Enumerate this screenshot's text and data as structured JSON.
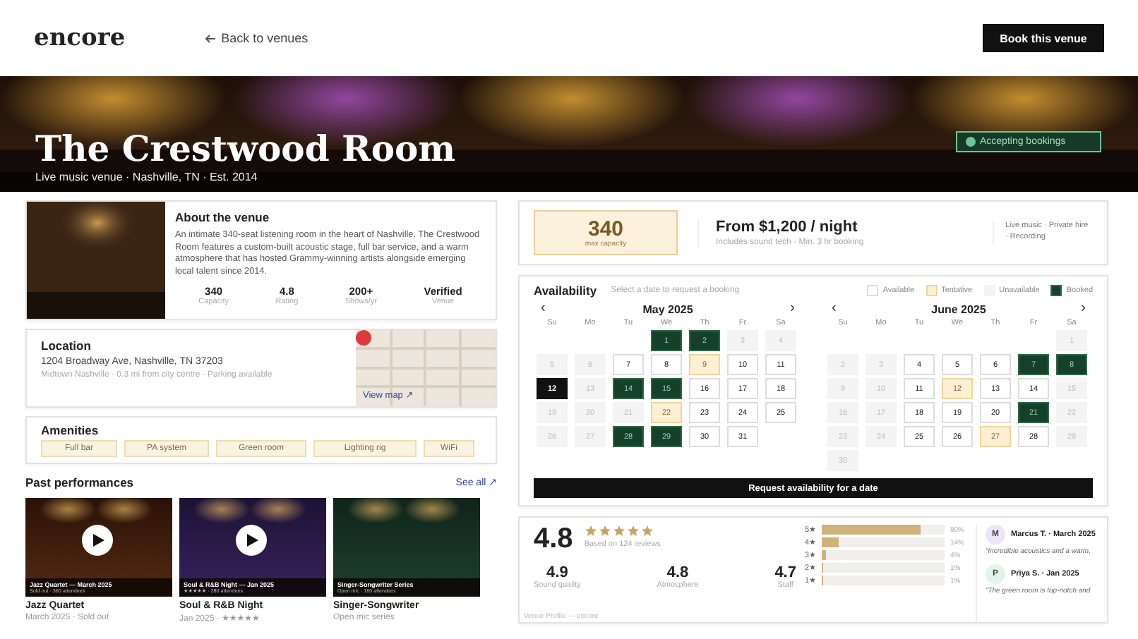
{
  "header": {
    "logo": "encore",
    "back_link": "Back to venues",
    "book_button": "Book this venue"
  },
  "hero": {
    "title": "The Crestwood Room",
    "meta": "Live music venue · Nashville, TN · Est. 2014",
    "status": "Accepting bookings"
  },
  "about": {
    "title": "About the venue",
    "text": "An intimate 340-seat listening room in the heart of Nashville. The Crestwood Room features a custom-built acoustic stage, full bar service, and a warm atmosphere that has hosted Grammy-winning artists alongside emerging local talent since 2014.",
    "stats": [
      {
        "value": "340",
        "label": "Capacity"
      },
      {
        "value": "4.8",
        "label": "Rating"
      },
      {
        "value": "200+",
        "label": "Shows/yr"
      },
      {
        "value": "Verified",
        "label": "Venue"
      }
    ]
  },
  "location": {
    "title": "Location",
    "address": "1204 Broadway Ave, Nashville, TN 37203",
    "details": "Midtown Nashville · 0.3 mi from city centre · Parking available",
    "map_link": "View map ↗"
  },
  "amenities": {
    "title": "Amenities",
    "items": [
      "Full bar",
      "PA system",
      "Green room",
      "Lighting rig",
      "WiFi"
    ]
  },
  "past_performances": {
    "title": "Past performances",
    "see_all": "See all ↗",
    "items": [
      {
        "caption": "Jazz Quartet — March 2025",
        "caption_sub": "Sold out · 360 attendees",
        "playable": true,
        "title": "Jazz Quartet",
        "meta": "March 2025 · Sold out"
      },
      {
        "caption": "Soul & R&B Night — Jan 2025",
        "caption_sub": "★★★★★ · 280 attendees",
        "playable": true,
        "title": "Soul & R&B Night",
        "meta": "Jan 2025 · ★★★★★"
      },
      {
        "caption": "Singer-Songwriter Series",
        "caption_sub": "Open mic · 160 attendees",
        "playable": false,
        "title": "Singer-Songwriter",
        "meta": "Open mic series"
      }
    ]
  },
  "pricing": {
    "capacity": "340",
    "capacity_label": "max capacity",
    "price": "From $1,200 / night",
    "price_note": "Includes sound tech · Min. 3 hr booking",
    "uses": "Live music · Private hire · Recording"
  },
  "availability": {
    "title": "Availability",
    "subtitle": "Select a date to request a booking",
    "legend": [
      {
        "label": "Available",
        "kind": "available"
      },
      {
        "label": "Tentative",
        "kind": "tentative"
      },
      {
        "label": "Unavailable",
        "kind": "unavailable"
      },
      {
        "label": "Booked",
        "kind": "booked"
      }
    ],
    "months": [
      {
        "title": "May 2025",
        "prev": "‹",
        "next": "›",
        "weekdays": [
          "Su",
          "Mo",
          "Tu",
          "We",
          "Th",
          "Fr",
          "Sa"
        ],
        "weeks": [
          [
            {
              "day": "1",
              "kind": "booked",
              "selected": false
            },
            {
              "day": "2",
              "kind": "booked",
              "selected": false
            },
            {
              "day": "3",
              "kind": "unavailable",
              "selected": false
            },
            {
              "day": "4",
              "kind": "unavailable",
              "selected": false
            }
          ],
          [
            {
              "day": "5",
              "kind": "unavailable",
              "selected": false
            },
            {
              "day": "6",
              "kind": "unavailable",
              "selected": false
            },
            {
              "day": "7",
              "kind": "available",
              "selected": false
            },
            {
              "day": "8",
              "kind": "available",
              "selected": false
            },
            {
              "day": "9",
              "kind": "tentative",
              "selected": false
            },
            {
              "day": "10",
              "kind": "available",
              "selected": false
            },
            {
              "day": "11",
              "kind": "available",
              "selected": false
            }
          ],
          [
            {
              "day": "12",
              "kind": "available",
              "selected": true
            },
            {
              "day": "13",
              "kind": "unavailable",
              "selected": false
            },
            {
              "day": "14",
              "kind": "booked",
              "selected": false
            },
            {
              "day": "15",
              "kind": "booked",
              "selected": false
            },
            {
              "day": "16",
              "kind": "available",
              "selected": false
            },
            {
              "day": "17",
              "kind": "available",
              "selected": false
            },
            {
              "day": "18",
              "kind": "available",
              "selected": false
            }
          ],
          [
            {
              "day": "19",
              "kind": "unavailable",
              "selected": false
            },
            {
              "day": "20",
              "kind": "unavailable",
              "selected": false
            },
            {
              "day": "21",
              "kind": "unavailable",
              "selected": false
            },
            {
              "day": "22",
              "kind": "tentative",
              "selected": false
            },
            {
              "day": "23",
              "kind": "available",
              "selected": false
            },
            {
              "day": "24",
              "kind": "available",
              "selected": false
            },
            {
              "day": "25",
              "kind": "available",
              "selected": false
            }
          ],
          [
            {
              "day": "26",
              "kind": "unavailable",
              "selected": false
            },
            {
              "day": "27",
              "kind": "unavailable",
              "selected": false
            },
            {
              "day": "28",
              "kind": "booked",
              "selected": false
            },
            {
              "day": "29",
              "kind": "booked",
              "selected": false
            },
            {
              "day": "30",
              "kind": "available",
              "selected": false
            },
            {
              "day": "31",
              "kind": "available",
              "selected": false
            }
          ]
        ]
      },
      {
        "title": "June 2025",
        "prev": "‹",
        "next": "›",
        "weekdays": [
          "Su",
          "Mo",
          "Tu",
          "We",
          "Th",
          "Fr",
          "Sa"
        ],
        "weeks": [
          [
            {
              "day": "1",
              "kind": "unavailable",
              "selected": false
            }
          ],
          [
            {
              "day": "2",
              "kind": "unavailable",
              "selected": false
            },
            {
              "day": "3",
              "kind": "unavailable",
              "selected": false
            },
            {
              "day": "4",
              "kind": "available",
              "selected": false
            },
            {
              "day": "5",
              "kind": "available",
              "selected": false
            },
            {
              "day": "6",
              "kind": "available",
              "selected": false
            },
            {
              "day": "7",
              "kind": "booked",
              "selected": false
            },
            {
              "day": "8",
              "kind": "booked",
              "selected": false
            }
          ],
          [
            {
              "day": "9",
              "kind": "unavailable",
              "selected": false
            },
            {
              "day": "10",
              "kind": "unavailable",
              "selected": false
            },
            {
              "day": "11",
              "kind": "available",
              "selected": false
            },
            {
              "day": "12",
              "kind": "tentative",
              "selected": false
            },
            {
              "day": "13",
              "kind": "available",
              "selected": false
            },
            {
              "day": "14",
              "kind": "available",
              "selected": false
            },
            {
              "day": "15",
              "kind": "unavailable",
              "selected": false
            }
          ],
          [
            {
              "day": "16",
              "kind": "unavailable",
              "selected": false
            },
            {
              "day": "17",
              "kind": "unavailable",
              "selected": false
            },
            {
              "day": "18",
              "kind": "available",
              "selected": false
            },
            {
              "day": "19",
              "kind": "available",
              "selected": false
            },
            {
              "day": "20",
              "kind": "available",
              "selected": false
            },
            {
              "day": "21",
              "kind": "booked",
              "selected": false
            },
            {
              "day": "22",
              "kind": "unavailable",
              "selected": false
            }
          ],
          [
            {
              "day": "23",
              "kind": "unavailable",
              "selected": false
            },
            {
              "day": "24",
              "kind": "unavailable",
              "selected": false
            },
            {
              "day": "25",
              "kind": "available",
              "selected": false
            },
            {
              "day": "26",
              "kind": "available",
              "selected": false
            },
            {
              "day": "27",
              "kind": "tentative",
              "selected": false
            },
            {
              "day": "28",
              "kind": "available",
              "selected": false
            },
            {
              "day": "29",
              "kind": "unavailable",
              "selected": false
            }
          ],
          [
            {
              "day": "30",
              "kind": "unavailable",
              "selected": false
            }
          ]
        ]
      }
    ],
    "request_button": "Request availability for a date"
  },
  "reviews": {
    "score": "4.8",
    "stars": 5,
    "based_on": "Based on 124 reviews",
    "subscores": [
      {
        "value": "4.9",
        "label": "Sound quality"
      },
      {
        "value": "4.8",
        "label": "Atmosphere"
      },
      {
        "value": "4.7",
        "label": "Staff"
      }
    ],
    "distribution": [
      {
        "label": "5★",
        "level": 0.8,
        "percent": "80%"
      },
      {
        "label": "4★",
        "level": 0.14,
        "percent": "14%"
      },
      {
        "label": "3★",
        "level": 0.04,
        "percent": "4%"
      },
      {
        "label": "2★",
        "level": 0.01,
        "percent": "1%"
      },
      {
        "label": "1★",
        "level": 0.01,
        "percent": "1%"
      }
    ],
    "items": [
      {
        "initial": "M",
        "color": "#ebe6f7",
        "byline": "Marcus T. · March 2025",
        "quote": "“Incredible acoustics and a warm,"
      },
      {
        "initial": "P",
        "color": "#e2f3ec",
        "byline": "Priya S. · Jan 2025",
        "quote": "“The green room is top-notch and"
      }
    ]
  },
  "footer": "Venue Profile — encore"
}
